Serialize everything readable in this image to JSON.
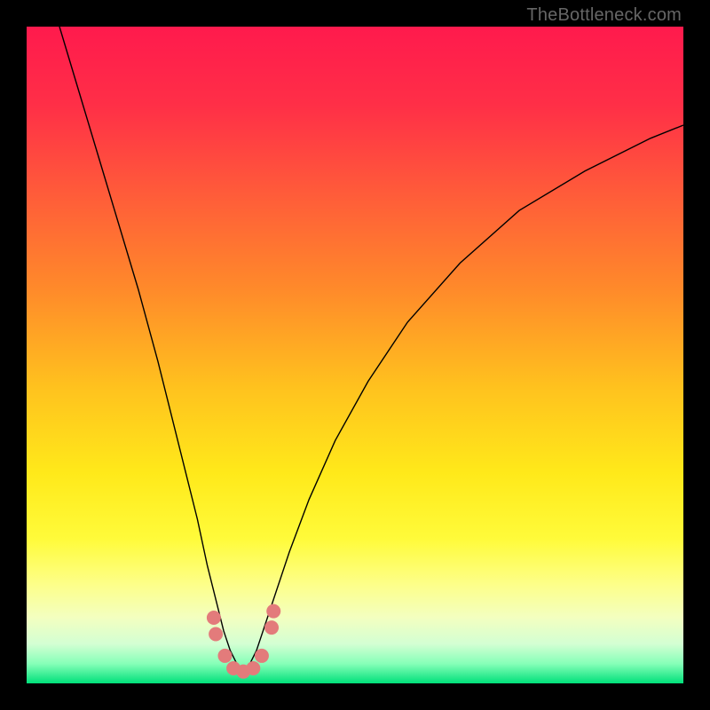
{
  "watermark": "TheBottleneck.com",
  "chart_data": {
    "type": "line",
    "title": "",
    "xlabel": "",
    "ylabel": "",
    "xlim": [
      0,
      100
    ],
    "ylim": [
      0,
      100
    ],
    "background_gradient": {
      "stops": [
        {
          "offset": 0.0,
          "color": "#ff1a4d"
        },
        {
          "offset": 0.12,
          "color": "#ff2f47"
        },
        {
          "offset": 0.25,
          "color": "#ff5a3a"
        },
        {
          "offset": 0.4,
          "color": "#ff8a2a"
        },
        {
          "offset": 0.55,
          "color": "#ffc21e"
        },
        {
          "offset": 0.68,
          "color": "#ffe91a"
        },
        {
          "offset": 0.78,
          "color": "#fffb3a"
        },
        {
          "offset": 0.85,
          "color": "#fdff8a"
        },
        {
          "offset": 0.9,
          "color": "#f3ffc0"
        },
        {
          "offset": 0.94,
          "color": "#d3ffd3"
        },
        {
          "offset": 0.97,
          "color": "#86ffb8"
        },
        {
          "offset": 1.0,
          "color": "#00e07a"
        }
      ]
    },
    "series": [
      {
        "name": "bottleneck-curve",
        "color": "#000000",
        "width": 1.4,
        "x": [
          5,
          8,
          11,
          14,
          17,
          20,
          22,
          24,
          26,
          27.5,
          29,
          30,
          31,
          32,
          33,
          34,
          35,
          36,
          38,
          40,
          43,
          47,
          52,
          58,
          66,
          75,
          85,
          95,
          100
        ],
        "y": [
          100,
          90,
          80,
          70,
          60,
          49,
          41,
          33,
          25,
          18,
          12,
          8,
          5,
          3,
          2,
          3,
          5,
          8,
          14,
          20,
          28,
          37,
          46,
          55,
          64,
          72,
          78,
          83,
          85
        ]
      }
    ],
    "markers": {
      "name": "valley-dots",
      "color": "#e37b7b",
      "radius": 8,
      "points": [
        {
          "x": 28.5,
          "y": 10
        },
        {
          "x": 28.8,
          "y": 7.5
        },
        {
          "x": 30.2,
          "y": 4.2
        },
        {
          "x": 31.5,
          "y": 2.3
        },
        {
          "x": 33.0,
          "y": 1.8
        },
        {
          "x": 34.5,
          "y": 2.3
        },
        {
          "x": 35.8,
          "y": 4.2
        },
        {
          "x": 37.3,
          "y": 8.5
        },
        {
          "x": 37.6,
          "y": 11
        }
      ]
    }
  }
}
